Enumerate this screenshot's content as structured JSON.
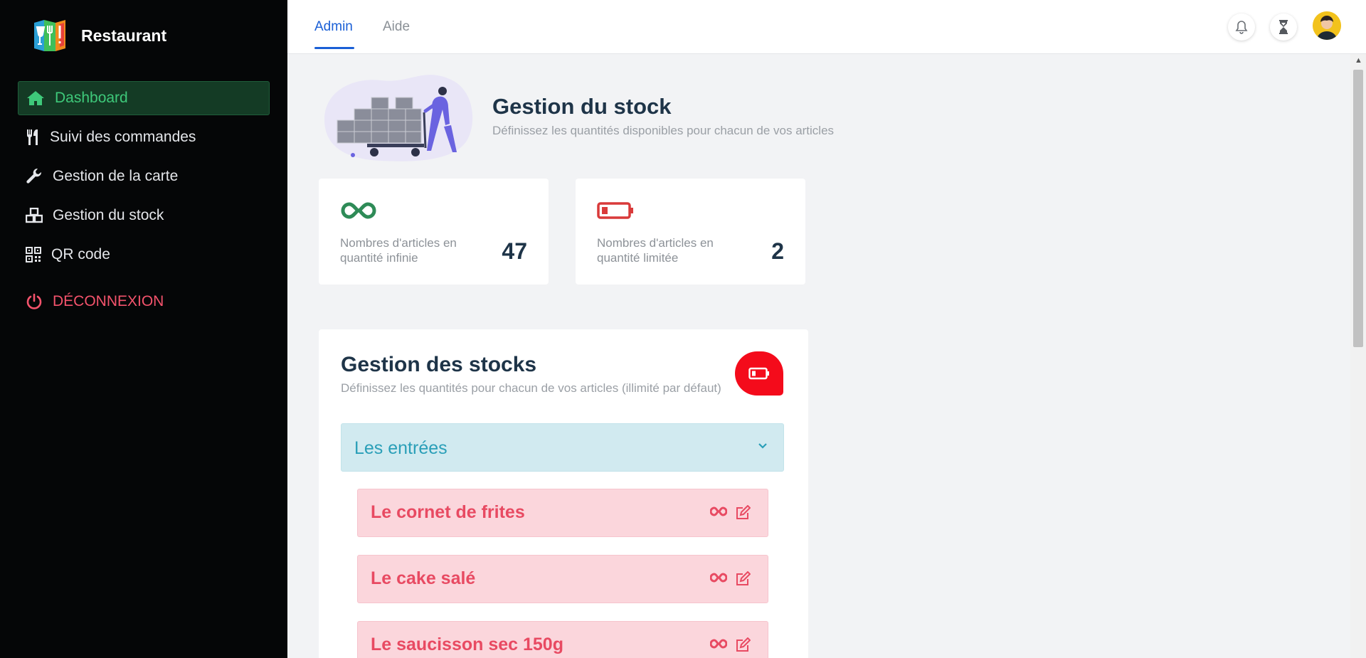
{
  "app": {
    "title": "Restaurant"
  },
  "sidebar": {
    "items": [
      {
        "label": "Dashboard",
        "icon": "home-icon"
      },
      {
        "label": "Suivi des commandes",
        "icon": "utensils-icon"
      },
      {
        "label": "Gestion de la carte",
        "icon": "wrench-icon"
      },
      {
        "label": "Gestion du stock",
        "icon": "boxes-icon"
      },
      {
        "label": "QR code",
        "icon": "qrcode-icon"
      }
    ],
    "logout_label": "DÉCONNEXION"
  },
  "topbar": {
    "tabs": [
      {
        "label": "Admin"
      },
      {
        "label": "Aide"
      }
    ],
    "icons": [
      "bell-icon",
      "hourglass-icon",
      "avatar"
    ]
  },
  "hero": {
    "title": "Gestion du stock",
    "subtitle": "Définissez les quantités disponibles pour chacun de vos articles"
  },
  "stats": [
    {
      "label": "Nombres d'articles en quantité infinie",
      "value": "47",
      "icon": "infinity-icon"
    },
    {
      "label": "Nombres d'articles en quantité limitée",
      "value": "2",
      "icon": "battery-low-icon"
    }
  ],
  "stock": {
    "title": "Gestion des stocks",
    "subtitle": "Définissez les quantités pour chacun de vos articles (illimité par défaut)",
    "category": "Les entrées",
    "items": [
      {
        "name": "Le cornet de frites"
      },
      {
        "name": "Le cake salé"
      },
      {
        "name": "Le saucisson sec 150g"
      }
    ]
  },
  "colors": {
    "sidebar_bg": "#050607",
    "active_green": "#3ec97a",
    "accent_blue": "#1a5fd6",
    "logout_red": "#f4536c",
    "category_teal": "#2a9fb8",
    "item_pink": "#fbd6dc",
    "item_red": "#e84a62",
    "badge_red": "#f40b1b"
  }
}
